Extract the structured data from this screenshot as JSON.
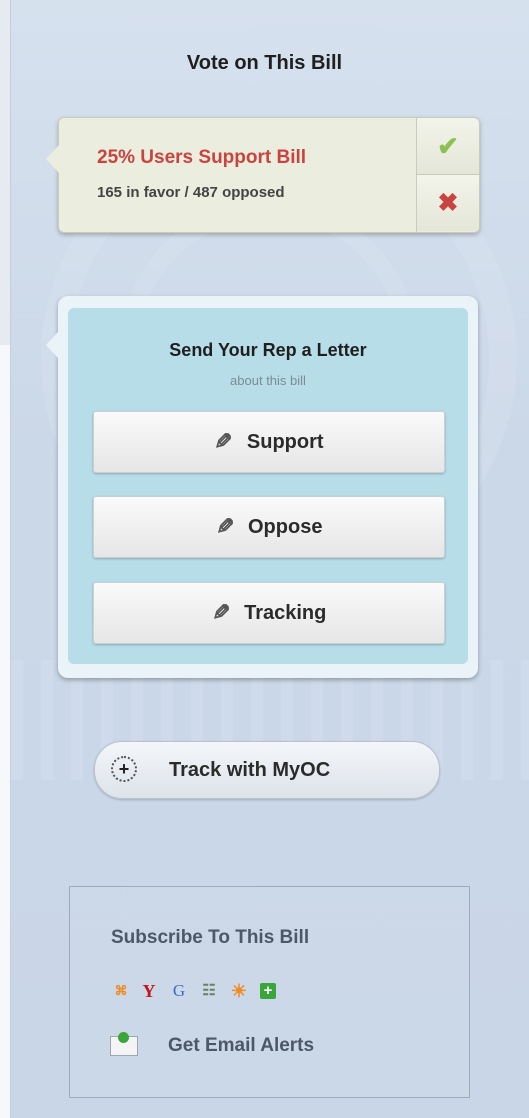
{
  "vote": {
    "title": "Vote on This Bill",
    "support_text": "25% Users Support Bill",
    "counts_text": "165 in favor / 487 opposed",
    "support_icon": "checkmark-icon",
    "oppose_icon": "x-icon"
  },
  "letter": {
    "title": "Send Your Rep a Letter",
    "subtitle": "about this bill",
    "buttons": [
      {
        "label": "Support",
        "icon": "pencil-icon"
      },
      {
        "label": "Oppose",
        "icon": "pencil-icon"
      },
      {
        "label": "Tracking",
        "icon": "pencil-icon"
      }
    ]
  },
  "track": {
    "label": "Track with MyOC",
    "icon": "plus-circle-icon"
  },
  "subscribe": {
    "title": "Subscribe To This Bill",
    "feeds": [
      {
        "name": "rss-icon",
        "glyph": "⌘"
      },
      {
        "name": "yahoo-icon",
        "glyph": "Y"
      },
      {
        "name": "google-icon",
        "glyph": "G"
      },
      {
        "name": "feed-reader-icon",
        "glyph": "☷"
      },
      {
        "name": "netvibes-icon",
        "glyph": "☀"
      },
      {
        "name": "add-feed-icon",
        "glyph": "+"
      }
    ],
    "email_label": "Get Email Alerts"
  },
  "colors": {
    "support_red": "#c9443f",
    "check_green": "#8cc152",
    "letter_bg": "#b7dde9"
  }
}
